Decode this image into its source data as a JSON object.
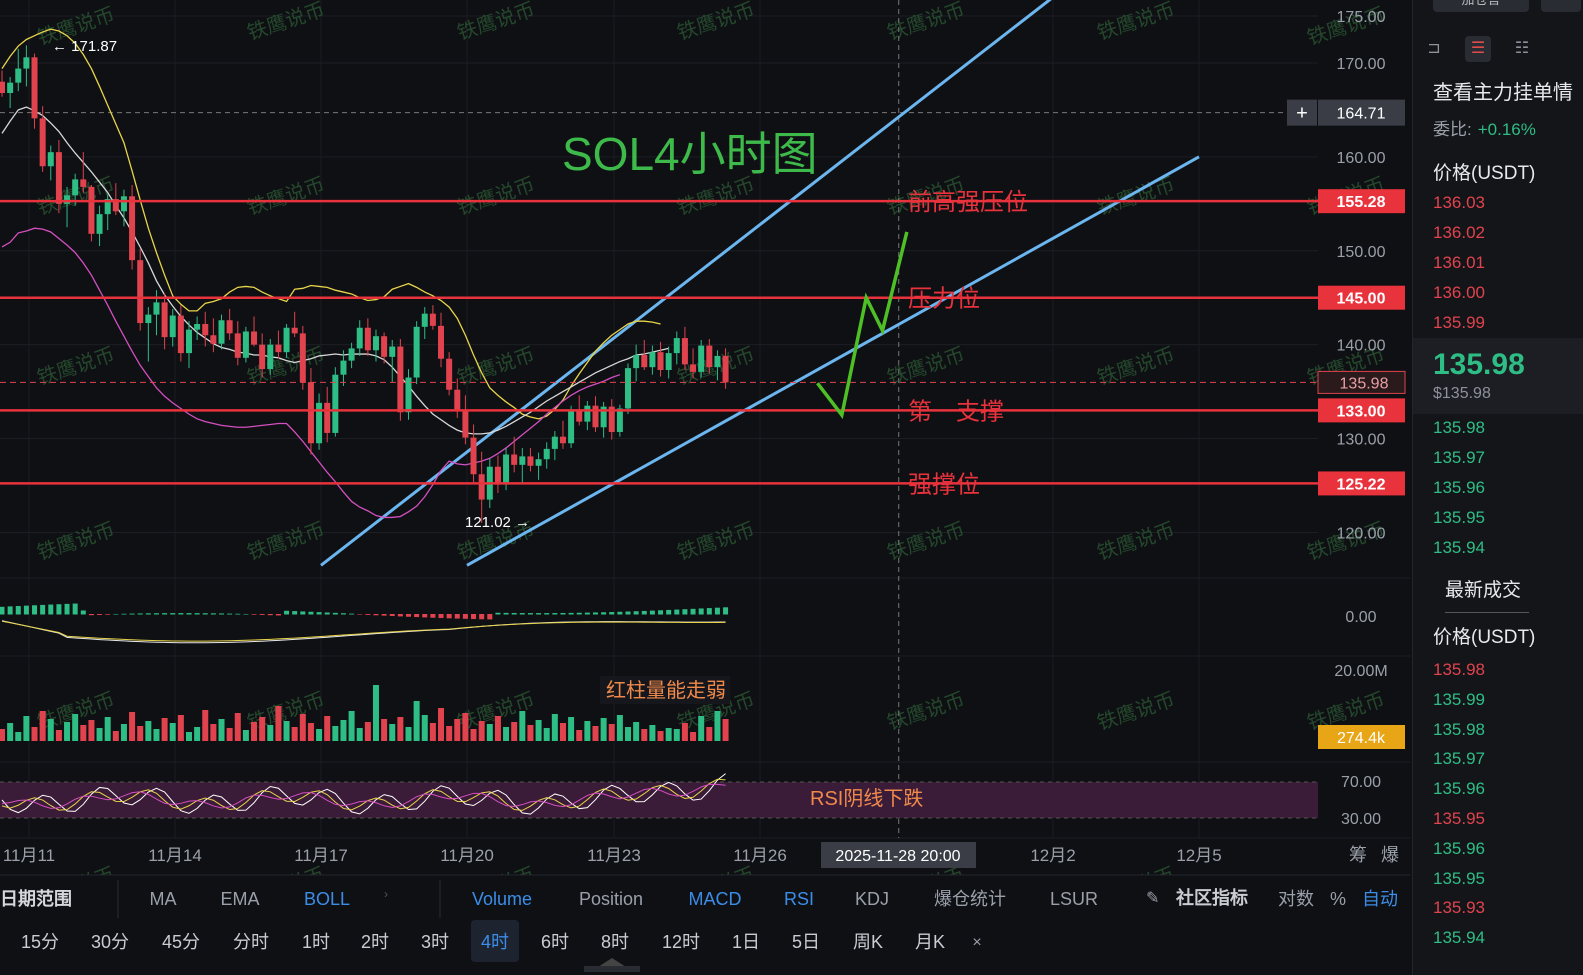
{
  "chart_data": {
    "type": "candlestick",
    "title": "SOL4小时图",
    "symbol": "SOL",
    "interval": "4时",
    "price_axis": {
      "ylim": [
        116.5,
        176.0
      ],
      "ticks": [
        175.0,
        170.0,
        160.0,
        150.0,
        140.0,
        130.0,
        120.0
      ],
      "tick_labels": [
        "175.00",
        "170.00",
        "160.00",
        "150.00",
        "140.00",
        "130.00",
        "120.00"
      ]
    },
    "x_axis": {
      "labels": [
        "11月11",
        "11月14",
        "11月17",
        "11月20",
        "11月23",
        "11月26",
        "12月2",
        "12月5"
      ],
      "crosshair_label": "2025-11-28 20:00"
    },
    "crosshair_price": "164.71",
    "last_price": {
      "value": 135.98,
      "label": "135.98",
      "color": "#e0434e"
    },
    "annotations": {
      "high": "171.87",
      "low": "121.02"
    },
    "levels": [
      {
        "price": 155.28,
        "label": "155.28",
        "name": "前高强压位"
      },
      {
        "price": 145.0,
        "label": "145.00",
        "name": "压力位"
      },
      {
        "price": 133.0,
        "label": "133.00",
        "name": "第一支撑"
      },
      {
        "price": 125.22,
        "label": "125.22",
        "name": "强撑位"
      }
    ],
    "channel": {
      "upper": [
        [
          "11月17",
          116.5
        ],
        [
          "12月2",
          177.0
        ]
      ],
      "lower": [
        [
          "11月20",
          116.5
        ],
        [
          "12月5",
          160.0
        ]
      ]
    },
    "box": {
      "from": "11月25",
      "to": "11月28",
      "top": 141.8,
      "bottom": 133.0
    },
    "projection": [
      [
        135.9,
        "11月27 04:00"
      ],
      [
        132.5,
        "11月27 16:00"
      ],
      [
        145.0,
        "11月28 04:00"
      ],
      [
        141.5,
        "11月28 12:00"
      ],
      [
        152.0,
        "11月29 00:00"
      ]
    ],
    "candles": [
      [
        168,
        169.2,
        166.4,
        166.8
      ],
      [
        166.8,
        168.5,
        165.2,
        167.9
      ],
      [
        167.9,
        171.5,
        167.0,
        169.4
      ],
      [
        169.4,
        171.87,
        167.5,
        170.6
      ],
      [
        170.6,
        171.0,
        163.0,
        164.1
      ],
      [
        164.1,
        165.4,
        158.4,
        159.0
      ],
      [
        159.0,
        161.2,
        157.5,
        160.5
      ],
      [
        160.5,
        161.8,
        154.0,
        155.0
      ],
      [
        155.0,
        156.8,
        152.5,
        155.9
      ],
      [
        155.9,
        158.2,
        154.8,
        157.6
      ],
      [
        157.6,
        160.5,
        156.2,
        156.8
      ],
      [
        156.8,
        157.0,
        151.0,
        151.8
      ],
      [
        151.8,
        154.8,
        150.5,
        153.9
      ],
      [
        153.9,
        156.0,
        152.2,
        155.5
      ],
      [
        155.5,
        157.2,
        153.8,
        154.2
      ],
      [
        154.2,
        156.5,
        152.6,
        155.8
      ],
      [
        155.8,
        157.0,
        148.0,
        149.0
      ],
      [
        149.0,
        150.2,
        141.5,
        142.3
      ],
      [
        142.3,
        144.0,
        138.2,
        143.2
      ],
      [
        143.2,
        145.8,
        141.0,
        144.5
      ],
      [
        144.5,
        145.5,
        139.5,
        140.8
      ],
      [
        140.8,
        143.8,
        139.8,
        143.1
      ],
      [
        143.1,
        144.2,
        138.2,
        139.1
      ],
      [
        139.1,
        142.5,
        137.5,
        141.6
      ],
      [
        141.6,
        143.0,
        140.5,
        142.2
      ],
      [
        142.2,
        143.5,
        139.8,
        141.0
      ],
      [
        141.0,
        142.8,
        139.2,
        140.1
      ],
      [
        140.1,
        143.2,
        139.5,
        142.6
      ],
      [
        142.6,
        143.8,
        140.5,
        141.2
      ],
      [
        141.2,
        142.5,
        137.8,
        138.6
      ],
      [
        138.6,
        141.9,
        138.1,
        141.4
      ],
      [
        141.4,
        143.0,
        139.8,
        140.0
      ],
      [
        140.0,
        141.2,
        136.5,
        137.4
      ],
      [
        137.4,
        140.6,
        136.8,
        140.0
      ],
      [
        140.0,
        141.5,
        138.5,
        139.2
      ],
      [
        139.2,
        142.2,
        138.6,
        141.8
      ],
      [
        141.8,
        143.5,
        140.8,
        141.2
      ],
      [
        141.2,
        142.0,
        135.2,
        136.0
      ],
      [
        136.0,
        137.5,
        128.3,
        129.5
      ],
      [
        129.5,
        134.8,
        128.8,
        133.8
      ],
      [
        133.8,
        135.5,
        129.6,
        130.6
      ],
      [
        130.6,
        137.6,
        130.2,
        136.8
      ],
      [
        136.8,
        139.4,
        135.6,
        138.3
      ],
      [
        138.3,
        140.2,
        137.5,
        139.6
      ],
      [
        139.6,
        142.6,
        138.8,
        141.8
      ],
      [
        141.8,
        142.8,
        138.8,
        139.4
      ],
      [
        139.4,
        141.6,
        138.2,
        140.9
      ],
      [
        140.9,
        141.3,
        138.0,
        138.7
      ],
      [
        138.7,
        140.5,
        136.0,
        139.8
      ],
      [
        139.8,
        140.6,
        131.9,
        132.8
      ],
      [
        132.8,
        137.4,
        132.0,
        136.5
      ],
      [
        136.5,
        142.5,
        135.8,
        141.9
      ],
      [
        141.9,
        144.0,
        140.6,
        143.3
      ],
      [
        143.3,
        144.2,
        141.6,
        142.0
      ],
      [
        142.0,
        143.4,
        137.6,
        138.5
      ],
      [
        138.5,
        139.2,
        134.6,
        135.2
      ],
      [
        135.2,
        136.4,
        132.2,
        133.0
      ],
      [
        133.0,
        134.6,
        129.4,
        130.1
      ],
      [
        130.1,
        131.5,
        125.3,
        126.2
      ],
      [
        126.2,
        128.6,
        121.02,
        123.5
      ],
      [
        123.5,
        127.9,
        122.6,
        127.0
      ],
      [
        127.0,
        128.2,
        124.2,
        125.1
      ],
      [
        125.1,
        129.0,
        124.5,
        128.3
      ],
      [
        128.3,
        130.2,
        126.4,
        127.2
      ],
      [
        127.2,
        129.0,
        125.2,
        128.1
      ],
      [
        128.1,
        129.0,
        126.5,
        127.1
      ],
      [
        127.1,
        128.5,
        125.6,
        127.8
      ],
      [
        127.8,
        129.6,
        126.8,
        128.9
      ],
      [
        128.9,
        130.8,
        127.7,
        130.2
      ],
      [
        130.2,
        131.9,
        128.9,
        129.5
      ],
      [
        129.5,
        133.5,
        129.0,
        133.1
      ],
      [
        133.1,
        134.6,
        131.4,
        131.8
      ],
      [
        131.8,
        134.0,
        130.9,
        133.5
      ],
      [
        133.5,
        134.5,
        130.7,
        131.2
      ],
      [
        131.2,
        133.9,
        130.1,
        133.4
      ],
      [
        133.4,
        134.2,
        129.9,
        130.7
      ],
      [
        130.7,
        133.6,
        130.2,
        133.2
      ],
      [
        133.2,
        138.0,
        132.6,
        137.5
      ],
      [
        137.5,
        140.0,
        136.1,
        138.9
      ],
      [
        138.9,
        140.5,
        137.3,
        137.6
      ],
      [
        137.6,
        139.9,
        136.8,
        139.2
      ],
      [
        139.2,
        140.3,
        136.6,
        137.3
      ],
      [
        137.3,
        139.8,
        136.4,
        139.1
      ],
      [
        139.1,
        141.4,
        137.9,
        140.7
      ],
      [
        140.7,
        141.9,
        137.3,
        137.9
      ],
      [
        137.9,
        139.6,
        136.4,
        137.1
      ],
      [
        137.1,
        140.5,
        136.5,
        139.9
      ],
      [
        139.9,
        140.6,
        136.9,
        137.6
      ],
      [
        137.6,
        139.4,
        136.2,
        138.8
      ],
      [
        138.8,
        139.6,
        135.3,
        135.98
      ]
    ],
    "boll": {
      "upper": [
        169.4,
        170.7,
        171.8,
        172.5,
        172.9,
        173.3,
        173.6,
        173.4,
        172.9,
        172.1,
        170.9,
        169.4,
        167.5,
        165.5,
        163.5,
        161.5,
        158.5,
        155.4,
        152.4,
        149.8,
        147.4,
        145.2,
        144.3,
        143.6,
        143.6,
        144.4,
        144.6,
        144.9,
        145.6,
        146.1,
        146.2,
        146.1,
        145.6,
        145.2,
        144.9,
        144.6,
        145.9,
        146.0,
        146.3,
        146.2,
        146.1,
        145.8,
        145.6,
        145.4,
        145.0,
        144.7,
        144.8,
        145.1,
        145.9,
        146.2,
        146.5,
        146.1,
        145.6,
        145.2,
        144.7,
        144.0,
        142.8,
        141.0,
        138.9,
        137.0,
        135.4,
        134.6,
        133.9,
        133.3,
        132.6,
        132.3,
        132.1,
        132.4,
        133.1,
        134.1,
        135.6,
        136.9,
        138.1,
        139.3,
        140.2,
        141.0,
        141.6,
        142.2,
        142.5,
        142.5,
        142.4,
        142.2
      ],
      "middle": [
        162.5,
        163.8,
        165.0,
        165.3,
        164.9,
        164.4,
        163.6,
        162.7,
        161.5,
        160.4,
        159.4,
        158.4,
        157.3,
        156.2,
        154.8,
        153.5,
        152.0,
        150.4,
        148.7,
        146.8,
        145.3,
        144.1,
        143.0,
        142.1,
        141.3,
        140.7,
        140.1,
        139.7,
        139.5,
        139.2,
        139.1,
        138.9,
        138.9,
        138.7,
        138.6,
        138.3,
        138.1,
        138.3,
        138.5,
        138.8,
        138.9,
        139.0,
        138.9,
        139.0,
        139.0,
        139.0,
        138.8,
        138.4,
        137.6,
        136.6,
        135.6,
        134.5,
        133.5,
        132.6,
        132.0,
        131.4,
        130.9,
        130.6,
        130.5,
        130.5,
        130.6,
        130.9,
        131.3,
        131.8,
        132.3,
        132.8,
        133.4,
        134.0,
        134.5,
        135.0,
        135.5,
        136.0,
        136.5,
        137.0,
        137.4,
        137.8,
        138.2,
        138.5,
        138.9,
        139.0,
        139.2,
        139.4,
        139.6
      ],
      "lower": [
        150.4,
        150.9,
        151.9,
        152.1,
        152.4,
        152.3,
        152.0,
        151.3,
        150.6,
        149.8,
        148.7,
        147.4,
        145.8,
        144.2,
        142.5,
        140.9,
        139.3,
        137.8,
        136.6,
        135.4,
        134.5,
        133.8,
        133.2,
        132.6,
        132.1,
        131.8,
        131.6,
        131.4,
        131.3,
        131.2,
        131.2,
        131.3,
        131.4,
        131.5,
        131.6,
        131.6,
        130.7,
        129.7,
        128.6,
        127.5,
        126.4,
        125.4,
        124.3,
        123.3,
        122.7,
        122.3,
        121.8,
        121.6,
        121.6,
        121.7,
        122.2,
        122.8,
        123.8,
        125.1,
        126.6,
        127.6,
        127.3,
        127.2,
        127.4,
        127.6,
        127.9,
        128.4,
        129.0,
        129.7,
        130.4,
        131.1,
        131.8,
        132.6,
        133.3,
        134.0,
        134.6,
        135.1,
        135.5,
        135.8,
        136.1,
        136.5,
        136.8
      ]
    },
    "macd_zero_label": "0.00",
    "volume": {
      "axis_label": "20.00M",
      "current": "274.4k",
      "note": "红柱量能走弱"
    },
    "rsi": {
      "levels": [
        "70.00",
        "30.00"
      ],
      "note": "RSI阴线下跌"
    },
    "watermark": "铁鹰说币"
  },
  "colors": {
    "up": "#2ebd85",
    "down": "#e0434e",
    "level": "#e8323c",
    "channel": "#6cb6f0",
    "projection": "#4ec026",
    "title": "#3dba4a",
    "boll_upper": "#e8d44a",
    "boll_mid": "#d8d8d8",
    "boll_lower": "#d44fc0",
    "box_fill": "#7a4040",
    "box_stroke": "#e8a23a",
    "rsi_band": "#3a1b38",
    "vol_tag": "#e8a515"
  },
  "toolbar": {
    "range": "日期范围",
    "indicators": [
      "MA",
      "EMA",
      "BOLL"
    ],
    "sub_indicators": [
      "Volume",
      "Position",
      "MACD",
      "RSI",
      "KDJ",
      "爆仓统计",
      "LSUR"
    ],
    "community": "社区指标",
    "log": "对数",
    "pct": "%",
    "auto": "自动",
    "intervals": [
      "15分",
      "30分",
      "45分",
      "分时",
      "1时",
      "2时",
      "3时",
      "4时",
      "6时",
      "8时",
      "12时",
      "1日",
      "5日",
      "周K",
      "月K"
    ],
    "close": "×",
    "corner": [
      "筹",
      "爆"
    ]
  },
  "sidebar": {
    "top_btn": "加仓言",
    "title": "查看主力挂单情",
    "ratio_label": "委比:",
    "ratio_value": "+0.16%",
    "price_header": "价格(USDT)",
    "asks": [
      "136.03",
      "136.02",
      "136.01",
      "136.00",
      "135.99"
    ],
    "last_price": "135.98",
    "last_usd": "$135.98",
    "bids": [
      "135.98",
      "135.97",
      "135.96",
      "135.95",
      "135.94"
    ],
    "trades_title": "最新成交",
    "trades_header": "价格(USDT)",
    "trades": [
      {
        "p": "135.98",
        "side": "sell"
      },
      {
        "p": "135.99",
        "side": "buy"
      },
      {
        "p": "135.98",
        "side": "buy"
      },
      {
        "p": "135.97",
        "side": "buy"
      },
      {
        "p": "135.96",
        "side": "buy"
      },
      {
        "p": "135.95",
        "side": "sell"
      },
      {
        "p": "135.96",
        "side": "buy"
      },
      {
        "p": "135.95",
        "side": "buy"
      },
      {
        "p": "135.93",
        "side": "sell"
      },
      {
        "p": "135.94",
        "side": "buy"
      }
    ]
  }
}
